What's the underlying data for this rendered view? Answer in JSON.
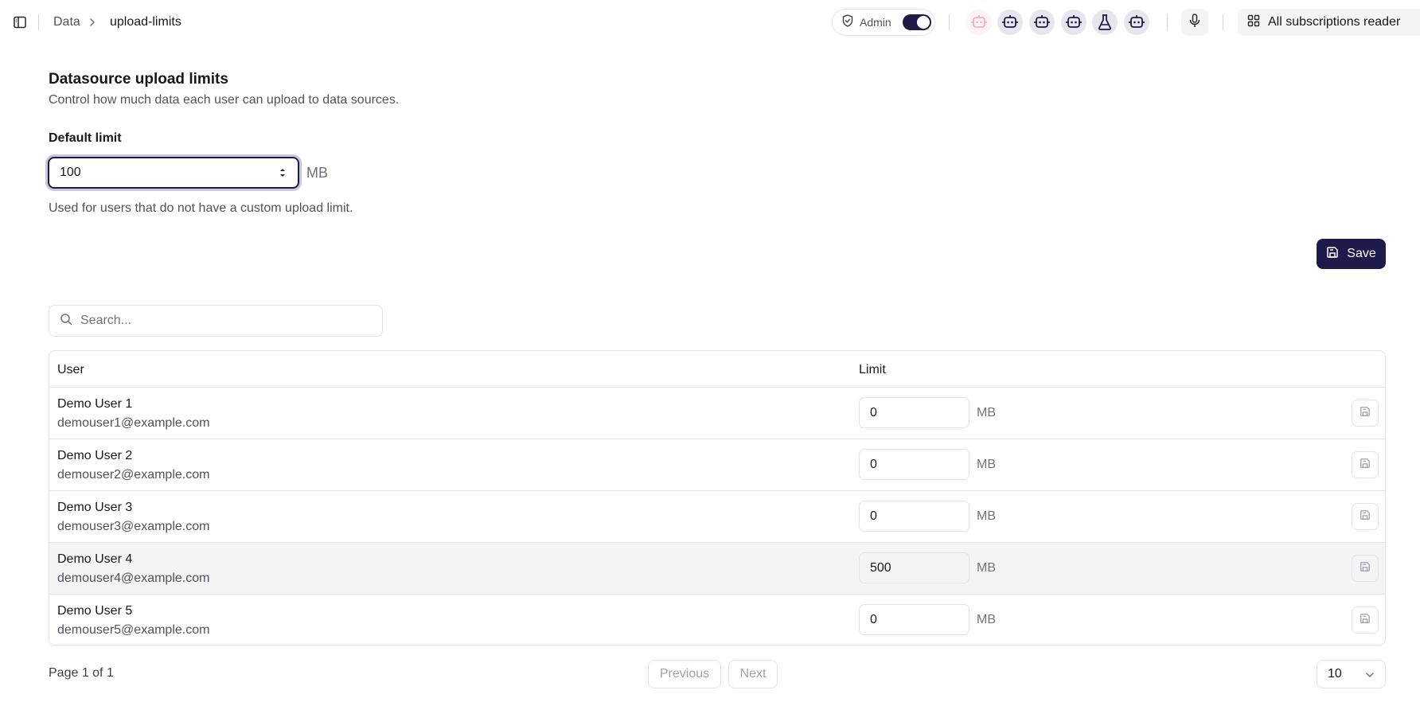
{
  "header": {
    "breadcrumb": [
      "Data",
      "upload-limits"
    ],
    "admin_label": "Admin",
    "admin_on": true,
    "subscriptions_label": "All subscriptions reader",
    "colors": {
      "primary": "#1e1b4b",
      "pink_bot": "#f4a6b7"
    }
  },
  "section": {
    "title": "Datasource upload limits",
    "description": "Control how much data each user can upload to data sources.",
    "default_label": "Default limit",
    "default_value": "100",
    "default_unit": "MB",
    "default_help": "Used for users that do not have a custom upload limit.",
    "save_label": "Save"
  },
  "search": {
    "placeholder": "Search..."
  },
  "table": {
    "columns": {
      "user": "User",
      "limit": "Limit"
    },
    "unit": "MB",
    "rows": [
      {
        "name": "Demo User 1",
        "email": "demouser1@example.com",
        "limit": "0"
      },
      {
        "name": "Demo User 2",
        "email": "demouser2@example.com",
        "limit": "0"
      },
      {
        "name": "Demo User 3",
        "email": "demouser3@example.com",
        "limit": "0"
      },
      {
        "name": "Demo User 4",
        "email": "demouser4@example.com",
        "limit": "500"
      },
      {
        "name": "Demo User 5",
        "email": "demouser5@example.com",
        "limit": "0"
      }
    ]
  },
  "pagination": {
    "page_info": "Page 1 of 1",
    "previous_label": "Previous",
    "next_label": "Next",
    "page_size": "10"
  }
}
